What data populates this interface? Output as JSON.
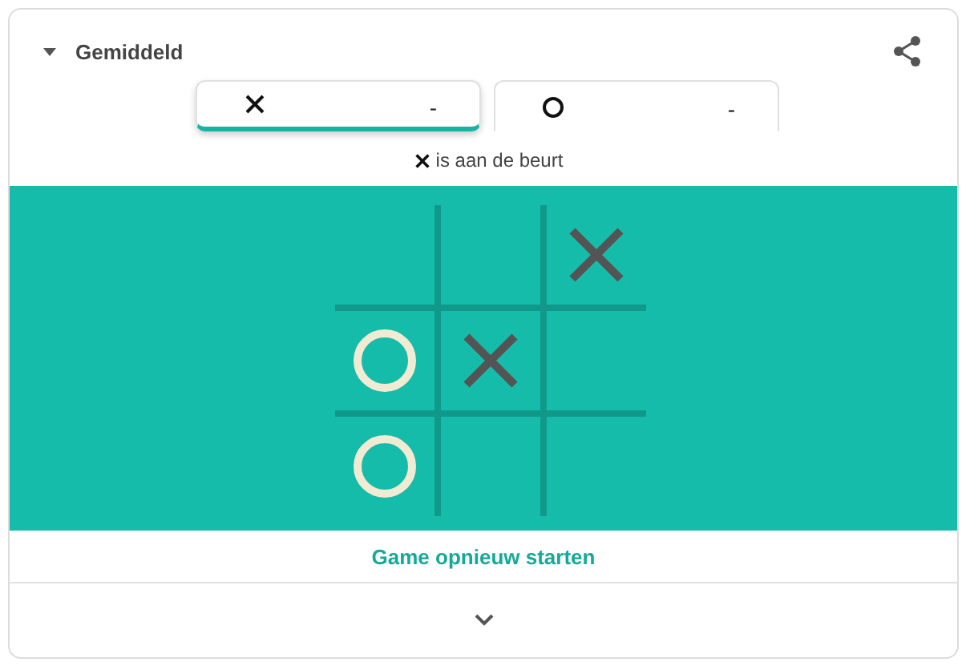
{
  "header": {
    "title": "Gemiddeld"
  },
  "players": [
    {
      "kind": "x",
      "score": "-",
      "selected": true
    },
    {
      "kind": "o",
      "score": "-",
      "selected": false
    }
  ],
  "turn": {
    "kind": "x",
    "text": "is aan de beurt"
  },
  "board": [
    {
      "kind": "empty"
    },
    {
      "kind": "empty"
    },
    {
      "kind": "x"
    },
    {
      "kind": "o"
    },
    {
      "kind": "x"
    },
    {
      "kind": "empty"
    },
    {
      "kind": "o"
    },
    {
      "kind": "empty"
    },
    {
      "kind": "empty"
    }
  ],
  "restart": "Game opnieuw starten"
}
